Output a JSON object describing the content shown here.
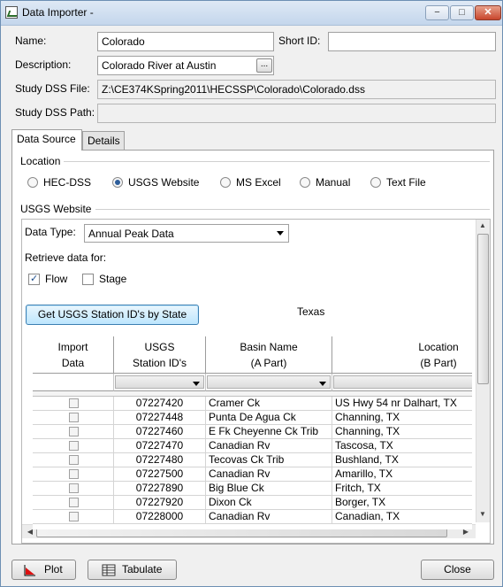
{
  "window": {
    "title": "Data Importer -",
    "min_glyph": "−",
    "max_glyph": "□",
    "close_glyph": "✕"
  },
  "form": {
    "name_label": "Name:",
    "name_value": "Colorado",
    "shortid_label": "Short ID:",
    "shortid_value": "",
    "description_label": "Description:",
    "description_value": "Colorado River at Austin",
    "browse_label": "...",
    "dss_file_label": "Study DSS File:",
    "dss_file_value": "Z:\\CE374KSpring2011\\HECSSP\\Colorado\\Colorado.dss",
    "dss_path_label": "Study DSS Path:",
    "dss_path_value": ""
  },
  "tabs": [
    {
      "label": "Data Source"
    },
    {
      "label": "Details"
    }
  ],
  "location": {
    "title": "Location",
    "options": [
      {
        "label": "HEC-DSS"
      },
      {
        "label": "USGS Website"
      },
      {
        "label": "MS Excel"
      },
      {
        "label": "Manual"
      },
      {
        "label": "Text File"
      }
    ],
    "selected": "USGS Website"
  },
  "usgs": {
    "title": "USGS Website",
    "data_type_label": "Data Type:",
    "data_type_value": "Annual Peak Data",
    "retrieve_label": "Retrieve data for:",
    "flow_label": "Flow",
    "flow_checked": true,
    "stage_label": "Stage",
    "stage_checked": false,
    "get_button": "Get USGS Station ID's by State",
    "state": "Texas"
  },
  "table": {
    "headers": [
      {
        "line1": "Import",
        "line2": "Data"
      },
      {
        "line1": "USGS",
        "line2": "Station ID's"
      },
      {
        "line1": "Basin Name",
        "line2": "(A Part)"
      },
      {
        "line1": "Location",
        "line2": "(B Part)"
      }
    ],
    "rows": [
      {
        "id": "07227420",
        "basin": "Cramer Ck",
        "location": "US Hwy 54 nr Dalhart, TX"
      },
      {
        "id": "07227448",
        "basin": "Punta De Agua Ck",
        "location": "Channing, TX"
      },
      {
        "id": "07227460",
        "basin": "E Fk Cheyenne Ck Trib",
        "location": "Channing, TX"
      },
      {
        "id": "07227470",
        "basin": "Canadian Rv",
        "location": "Tascosa, TX"
      },
      {
        "id": "07227480",
        "basin": "Tecovas Ck Trib",
        "location": "Bushland, TX"
      },
      {
        "id": "07227500",
        "basin": "Canadian Rv",
        "location": "Amarillo, TX"
      },
      {
        "id": "07227890",
        "basin": "Big Blue Ck",
        "location": "Fritch, TX"
      },
      {
        "id": "07227920",
        "basin": "Dixon Ck",
        "location": "Borger, TX"
      },
      {
        "id": "07228000",
        "basin": "Canadian Rv",
        "location": "Canadian, TX"
      }
    ]
  },
  "footer": {
    "plot": "Plot",
    "tabulate": "Tabulate",
    "close": "Close"
  }
}
